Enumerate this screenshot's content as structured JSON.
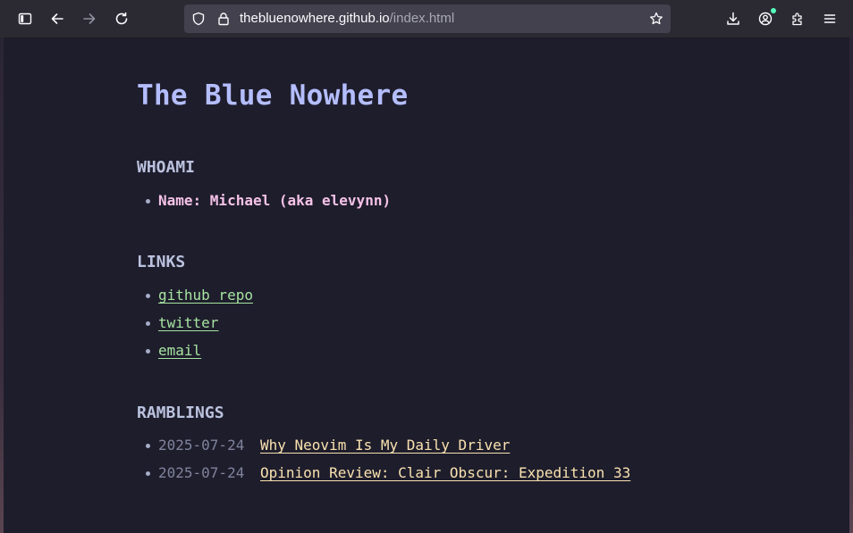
{
  "browser": {
    "url_host": "thebluenowhere.github.io",
    "url_path": "/index.html",
    "icons": [
      "sidebar-icon",
      "back-icon",
      "forward-icon",
      "reload-icon",
      "shield-icon",
      "lock-icon",
      "bookmark-star-icon",
      "download-icon",
      "account-icon",
      "extensions-icon",
      "menu-icon"
    ]
  },
  "page": {
    "title": "The Blue Nowhere",
    "whoami": {
      "heading": "WHOAMI",
      "items": [
        "Name: Michael (aka elevynn)"
      ]
    },
    "links": {
      "heading": "LINKS",
      "items": [
        {
          "label": "github repo"
        },
        {
          "label": "twitter"
        },
        {
          "label": "email"
        }
      ]
    },
    "ramblings": {
      "heading": "RAMBLINGS",
      "posts": [
        {
          "date": "2025-07-24",
          "title": "Why Neovim Is My Daily Driver"
        },
        {
          "date": "2025-07-24",
          "title": "Opinion Review: Clair Obscur: Expedition 33"
        }
      ]
    }
  },
  "colors": {
    "background": "#1e1d2c",
    "title": "#b4befe",
    "heading": "#bac2de",
    "whoami_text": "#f5c2e7",
    "link_green": "#a6e3a1",
    "post_link": "#f9e2af",
    "date_gray": "#7f849c"
  }
}
